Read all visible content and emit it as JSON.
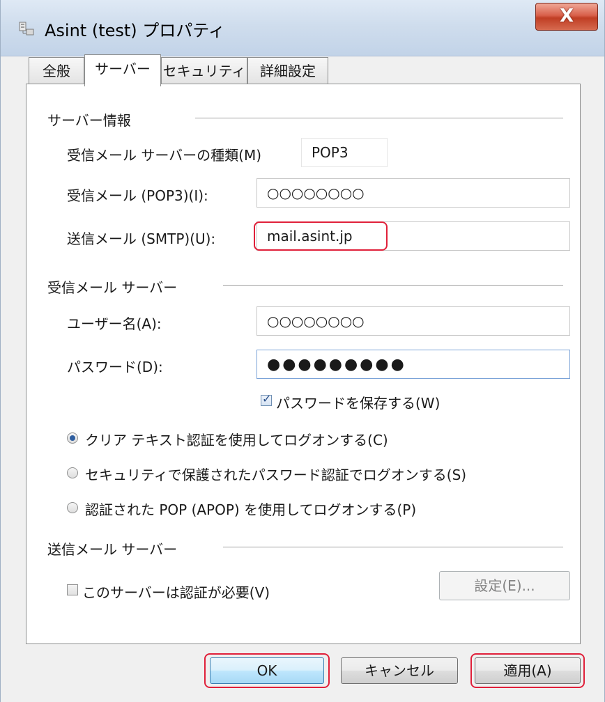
{
  "window": {
    "title": "Asint (test) プロパティ",
    "close_label": "X"
  },
  "tabs": [
    {
      "label": "全般"
    },
    {
      "label": "サーバー"
    },
    {
      "label": "セキュリティ"
    },
    {
      "label": "詳細設定"
    }
  ],
  "active_tab": "サーバー",
  "server_info": {
    "section_title": "サーバー情報",
    "incoming_type_label": "受信メール サーバーの種類(M)",
    "incoming_type_value": "POP3",
    "incoming_label": "受信メール (POP3)(I):",
    "incoming_value": "○○○○○○○○",
    "outgoing_label": "送信メール (SMTP)(U):",
    "outgoing_value": "mail.asint.jp"
  },
  "incoming_server": {
    "section_title": "受信メール サーバー",
    "username_label": "ユーザー名(A):",
    "username_value": "○○○○○○○○",
    "password_label": "パスワード(D):",
    "password_value": "●●●●●●●●●",
    "save_password_label": "パスワードを保存する(W)",
    "save_password_checked": true,
    "auth_options": [
      {
        "label": "クリア テキスト認証を使用してログオンする(C)",
        "selected": true
      },
      {
        "label": "セキュリティで保護されたパスワード認証でログオンする(S)",
        "selected": false
      },
      {
        "label": "認証された POP (APOP) を使用してログオンする(P)",
        "selected": false
      }
    ]
  },
  "outgoing_server": {
    "section_title": "送信メール サーバー",
    "auth_required_label": "このサーバーは認証が必要(V)",
    "auth_required_checked": false,
    "settings_button": "設定(E)..."
  },
  "footer": {
    "ok_label": "OK",
    "cancel_label": "キャンセル",
    "apply_label": "適用(A)"
  },
  "colors": {
    "highlight": "#e0203a",
    "titlebar": "#cfdded",
    "close_button": "#c03e24"
  }
}
